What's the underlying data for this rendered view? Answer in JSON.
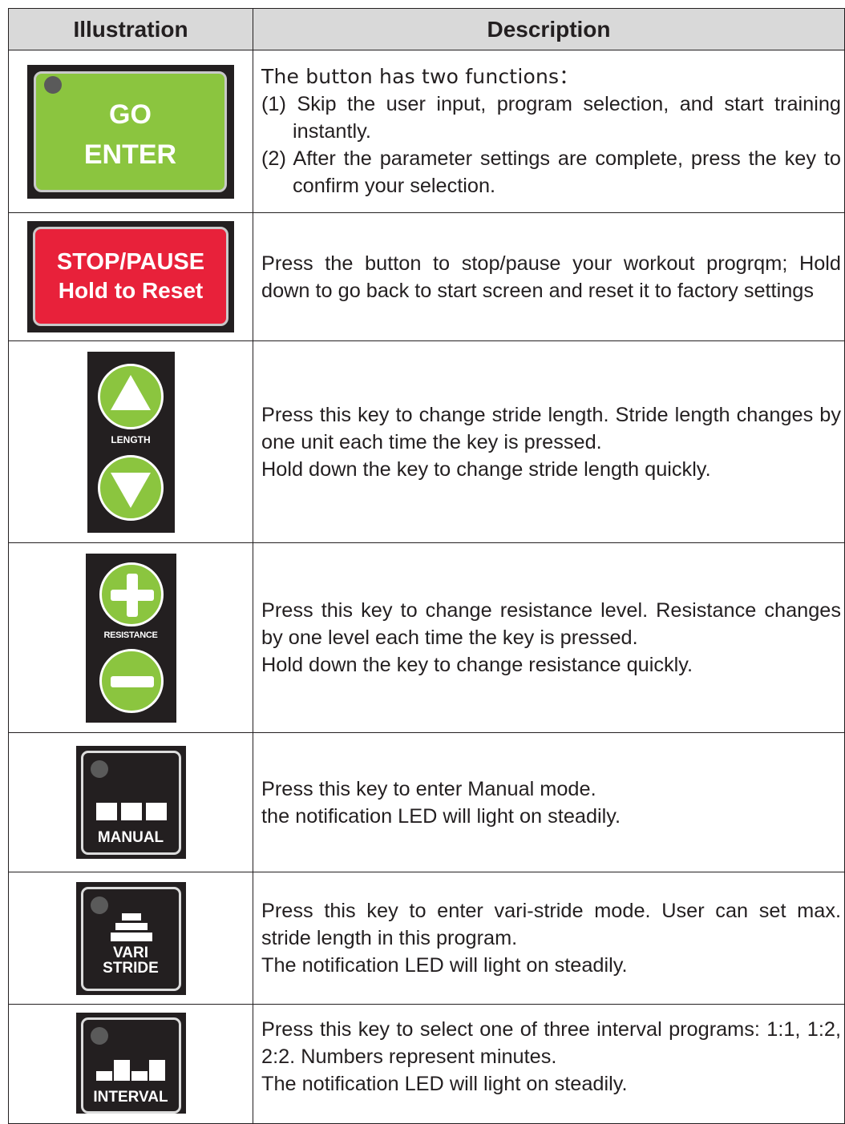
{
  "header": {
    "illustration": "Illustration",
    "description": "Description"
  },
  "rows": {
    "go_enter": {
      "key_line1": "GO",
      "key_line2": "ENTER",
      "intro": "The button has two functions：",
      "item1": "(1) Skip the user input, program selection, and start training instantly.",
      "item2": "(2) After the parameter settings are complete, press the key to confirm your selection."
    },
    "stop_pause": {
      "key_line1": "STOP/PAUSE",
      "key_line2": "Hold to Reset",
      "text": "Press the button to stop/pause your workout progrqm; Hold down to go back to start screen and reset it to factory settings"
    },
    "length": {
      "key_label": "LENGTH",
      "line1": "Press this key to change stride length. Stride length changes by one unit each time the key is pressed.",
      "line2": "Hold down the key to change stride length quickly."
    },
    "resistance": {
      "key_label": "RESISTANCE",
      "line1": "Press this key to change resistance level. Resistance changes by one level each time the key is pressed.",
      "line2": "Hold down the key to change resistance quickly."
    },
    "manual": {
      "key_label": "MANUAL",
      "line1": "Press this key to enter Manual mode.",
      "line2": "the notification LED will light on steadily."
    },
    "vari_stride": {
      "key_line1": "VARI",
      "key_line2": "STRIDE",
      "line1": "Press this key to enter vari-stride mode. User can set max. stride length in this program.",
      "line2": "The notification LED will light on steadily."
    },
    "interval": {
      "key_label": "INTERVAL",
      "line1": "Press this key to select one of three interval programs: 1:1, 1:2, 2:2. Numbers represent minutes.",
      "line2": "The notification LED will light on steadily."
    }
  },
  "colors": {
    "green_key": "#8bc53f",
    "red_key": "#e8213a",
    "panel_black": "#231f20",
    "header_gray": "#d9d9d9"
  },
  "icons": [
    "led-indicator-icon",
    "arrow-up-icon",
    "arrow-down-icon",
    "plus-icon",
    "minus-icon",
    "manual-bars-icon",
    "stacked-steps-icon",
    "interval-bars-icon"
  ]
}
